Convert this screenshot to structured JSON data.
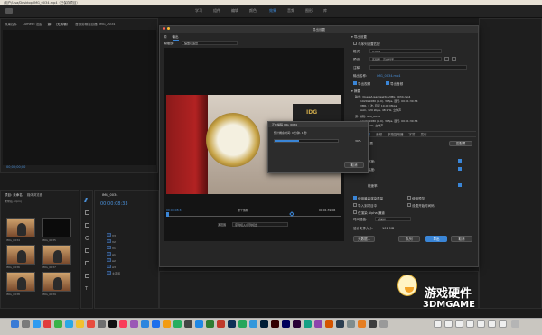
{
  "topbar": {
    "title": "/用户/Lisa/Desktop/IMG_0034.mp4（已保存项目）"
  },
  "nav": {
    "items": [
      "学习",
      "组件",
      "编辑",
      "颜色",
      "效果",
      "音频",
      "图形",
      "库"
    ],
    "active_index": 4
  },
  "left_tabs": {
    "source": "效果控件",
    "lumetri": "Lumetri 范围",
    "source2": "源：（无剪辑）",
    "audio_mixer": "音频剪辑混合器: IMG_0034"
  },
  "source_timecode": "00;00;00;00",
  "project_panel": {
    "tab1": "项目: 未命名",
    "tab2": "媒体浏览器",
    "file": "未命名.prproj",
    "thumbs": [
      "IMG_0034",
      "IMG_0035",
      "IMG_0036",
      "IMG_0037",
      "IMG_0038",
      "IMG_0039",
      "IMG_0040",
      "IMG_0041"
    ]
  },
  "timeline": {
    "tab": "IMG_0034",
    "timecode": "00:00:08:33",
    "tracks": [
      "V3",
      "V2",
      "V1",
      "A1",
      "A2",
      "A3",
      "主声道"
    ]
  },
  "export_dialog": {
    "title": "导出设置",
    "tab_source": "源",
    "tab_output": "输出",
    "source_scale_label": "源缩放:",
    "source_scale_value": "缩放以适合",
    "timecode_start": "00:00:08:33",
    "timecode_end": "00:01:39:06",
    "range_label": "源范围:",
    "range_value": "整个剪辑",
    "fit_label": "源范围",
    "fit_value": "序列切入/序列切出",
    "settings_header": "导出设置",
    "match_sequence": "与序列设置匹配",
    "format_label": "格式:",
    "format_value": "H.264",
    "preset_label": "预设:",
    "preset_value": "匹配源 - 高比特率",
    "comment_label": "注释:",
    "output_name_label": "输出名称:",
    "output_name_value": "IMG_0034.mp4",
    "export_video": "导出视频",
    "export_audio": "导出音频",
    "summary_header": "摘要",
    "summary_output": "输出: /Users/Lisa/Desktop/IMG_0034.mp4",
    "summary_output2": "1920x1080 (1.0), 30fps, 逐行, 00:01:30:34",
    "summary_output3": "VBR, 1 次, 目标 10.00 Mbps",
    "summary_output4": "AAC, 320 kbps, 48 kHz, 立体声",
    "summary_source": "源: 剪辑, IMG_0034",
    "summary_source2": "1920x1080 (1.0), 30fps, 逐行, 00:01:30:34",
    "summary_source3": "48000 Hz, 立体声",
    "tabs": [
      "效果",
      "视频",
      "音频",
      "多路复用器",
      "字幕",
      "发布"
    ],
    "basic_settings": "基本视频设置",
    "match_source_btn": "匹配源",
    "width_label": "宽度:",
    "height_label": "高度:",
    "bitrate_label": "帧速率:",
    "max_quality": "使用最高渲染质量",
    "use_preview": "使用预览",
    "import_project": "导入到项目中",
    "set_start": "设置开始时间码",
    "render_alpha": "仅渲染 Alpha 通道",
    "interpolation_label": "时间插值:",
    "interpolation_value": "帧采样",
    "file_size_label": "估计文件大小:",
    "file_size_value": "101 MB",
    "metadata_btn": "元数据...",
    "queue_btn": "队列",
    "export_btn": "导出",
    "cancel_btn": "取消"
  },
  "progress_dialog": {
    "title": "正在编码 IMG_0034",
    "message": "预计剩余时间: 0 分钟, 1 秒",
    "percent": "39%",
    "progress_value": 0.39,
    "cancel": "取消"
  },
  "watermark": {
    "text_cn": "游戏硬件",
    "text_en": "3DMGAME"
  },
  "colors": {
    "accent": "#3a85d6",
    "dock_bg": "#c9c6c0"
  }
}
